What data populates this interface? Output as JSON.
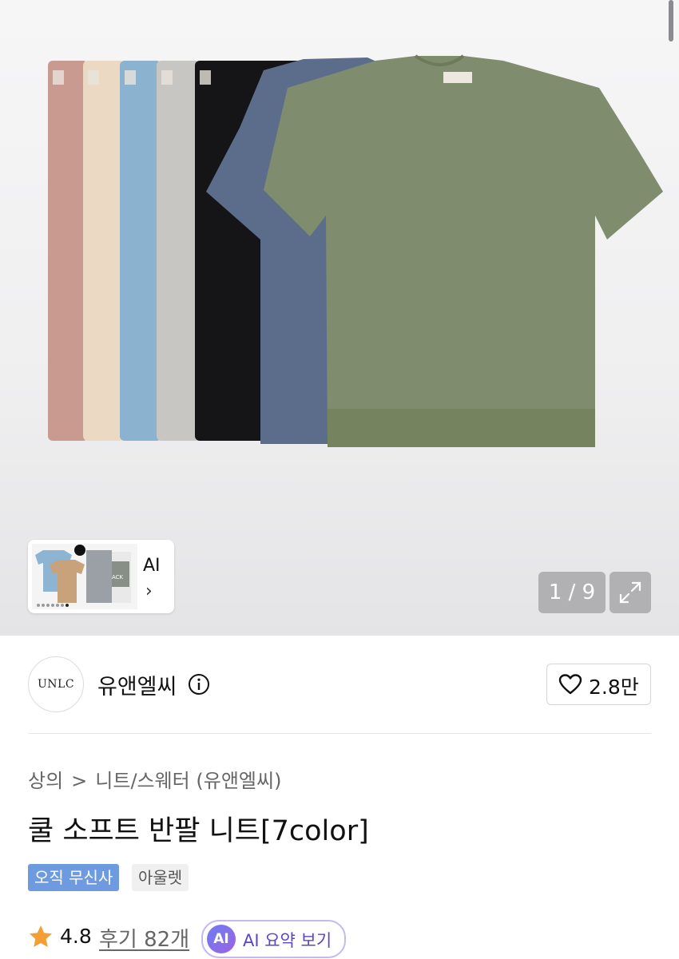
{
  "gallery": {
    "counter": "1 / 9",
    "ai_thumb_label": "AI",
    "ai_thumb_chevron": "›",
    "shirt_colors": [
      "#c99a90",
      "#ecd9c4",
      "#8bb3cf",
      "#c8c6c3",
      "#151518",
      "#5c6d8c",
      "#7f8c6e"
    ]
  },
  "brand": {
    "logo_text": "UNLC",
    "name": "유앤엘씨",
    "like_count": "2.8만"
  },
  "breadcrumb": {
    "category": "상의",
    "separator": ">",
    "subcategory": "니트/스웨터 (유앤엘씨)"
  },
  "product": {
    "title": "쿨 소프트 반팔 니트[7color]",
    "tags": [
      "오직 무신사",
      "아울렛"
    ],
    "rating": "4.8",
    "reviews": "후기 82개",
    "ai_badge": "AI",
    "ai_summary_label": "AI 요약 보기"
  },
  "colors": {
    "tag_blue": "#6e9be0",
    "star": "#f29f35",
    "ai_purple": "#5a47c8"
  }
}
